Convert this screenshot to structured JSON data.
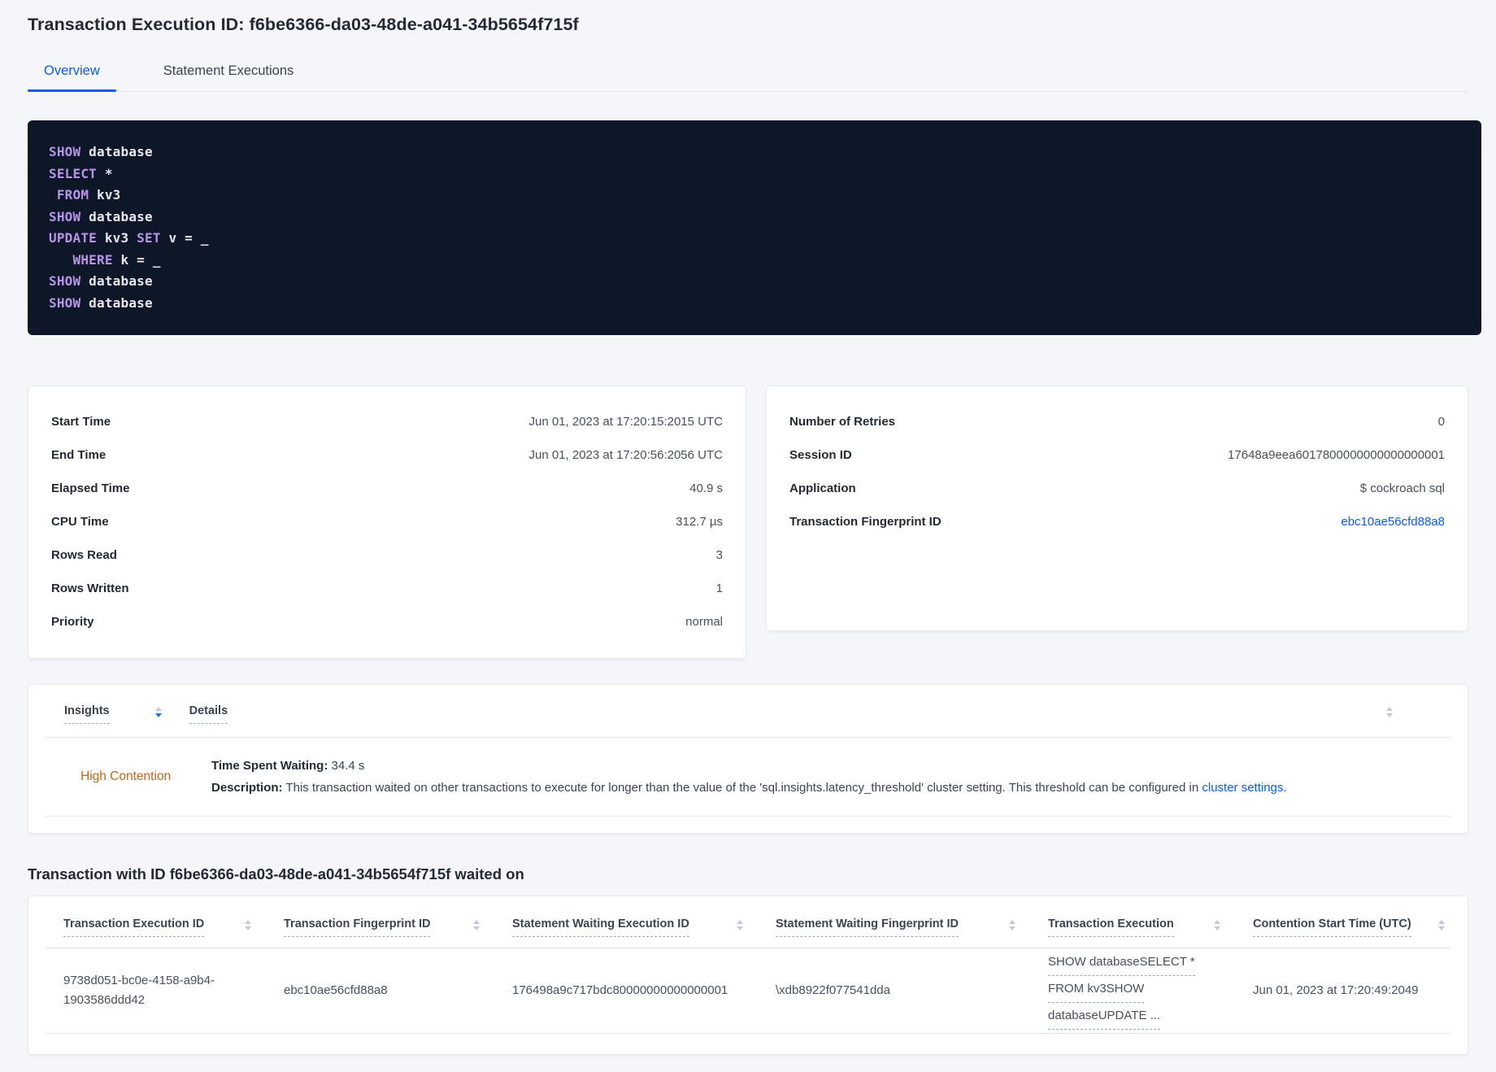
{
  "page": {
    "title": "Transaction Execution ID: f6be6366-da03-48de-a041-34b5654f715f",
    "tabs": [
      {
        "label": "Overview"
      },
      {
        "label": "Statement Executions"
      }
    ]
  },
  "colors": {
    "accent_blue": "#0b5cf5",
    "insight_orange": "#c2661a",
    "sql_bg": "#0e1728",
    "sql_keyword": "#b992e9"
  },
  "sql": {
    "lines": [
      [
        {
          "t": "SHOW",
          "c": "kw"
        },
        {
          "t": " database",
          "c": "id"
        }
      ],
      [
        {
          "t": "SELECT",
          "c": "kw"
        },
        {
          "t": " *",
          "c": "id"
        }
      ],
      [
        {
          "t": " ",
          "c": "id"
        },
        {
          "t": "FROM",
          "c": "kw"
        },
        {
          "t": " kv3",
          "c": "id"
        }
      ],
      [
        {
          "t": "SHOW",
          "c": "kw"
        },
        {
          "t": " database",
          "c": "id"
        }
      ],
      [
        {
          "t": "UPDATE",
          "c": "kw"
        },
        {
          "t": " kv3 ",
          "c": "id"
        },
        {
          "t": "SET",
          "c": "kw"
        },
        {
          "t": " v = _",
          "c": "id"
        }
      ],
      [
        {
          "t": "   ",
          "c": "id"
        },
        {
          "t": "WHERE",
          "c": "kw"
        },
        {
          "t": " k = _",
          "c": "id"
        }
      ],
      [
        {
          "t": "SHOW",
          "c": "kw"
        },
        {
          "t": " database",
          "c": "id"
        }
      ],
      [
        {
          "t": "SHOW",
          "c": "kw"
        },
        {
          "t": " database",
          "c": "id"
        }
      ]
    ]
  },
  "summary_left": {
    "rows": [
      {
        "label": "Start Time",
        "value": "Jun 01, 2023 at 17:20:15:2015 UTC"
      },
      {
        "label": "End Time",
        "value": "Jun 01, 2023 at 17:20:56:2056 UTC"
      },
      {
        "label": "Elapsed Time",
        "value": "40.9 s"
      },
      {
        "label": "CPU Time",
        "value": "312.7 µs"
      },
      {
        "label": "Rows Read",
        "value": "3"
      },
      {
        "label": "Rows Written",
        "value": "1"
      },
      {
        "label": "Priority",
        "value": "normal"
      }
    ]
  },
  "summary_right": {
    "rows": [
      {
        "label": "Number of Retries",
        "value": "0"
      },
      {
        "label": "Session ID",
        "value": "17648a9eea6017800000000000000001"
      },
      {
        "label": "Application",
        "value": "$ cockroach sql"
      },
      {
        "label": "Transaction Fingerprint ID",
        "value": "ebc10ae56cfd88a8",
        "link": true
      }
    ]
  },
  "insights": {
    "col_insights": "Insights",
    "col_details": "Details",
    "row": {
      "insight": "High Contention",
      "waiting_label": "Time Spent Waiting:",
      "waiting_value": " 34.4 s",
      "description_label": "Description:",
      "description_text": " This transaction waited on other transactions to execute for longer than the value of the 'sql.insights.latency_threshold' cluster setting. This threshold can be configured in ",
      "description_link": "cluster settings",
      "description_suffix": "."
    }
  },
  "waited_section": {
    "heading": "Transaction with ID f6be6366-da03-48de-a041-34b5654f715f waited on",
    "columns": [
      "Transaction Execution ID",
      "Transaction Fingerprint ID",
      "Statement Waiting Execution ID",
      "Statement Waiting Fingerprint ID",
      "Transaction Execution",
      "Contention Start Time (UTC)"
    ],
    "rows": [
      {
        "transaction_execution_id": "9738d051-bc0e-4158-a9b4-1903586ddd42",
        "transaction_fingerprint_id": "ebc10ae56cfd88a8",
        "statement_waiting_execution_id": "176498a9c717bdc80000000000000001",
        "statement_waiting_fingerprint_id": "\\xdb8922f077541dda",
        "transaction_execution_lines": [
          "SHOW databaseSELECT *",
          "FROM kv3SHOW",
          "databaseUPDATE ..."
        ],
        "contention_start_time": "Jun 01, 2023 at 17:20:49:2049"
      }
    ]
  }
}
